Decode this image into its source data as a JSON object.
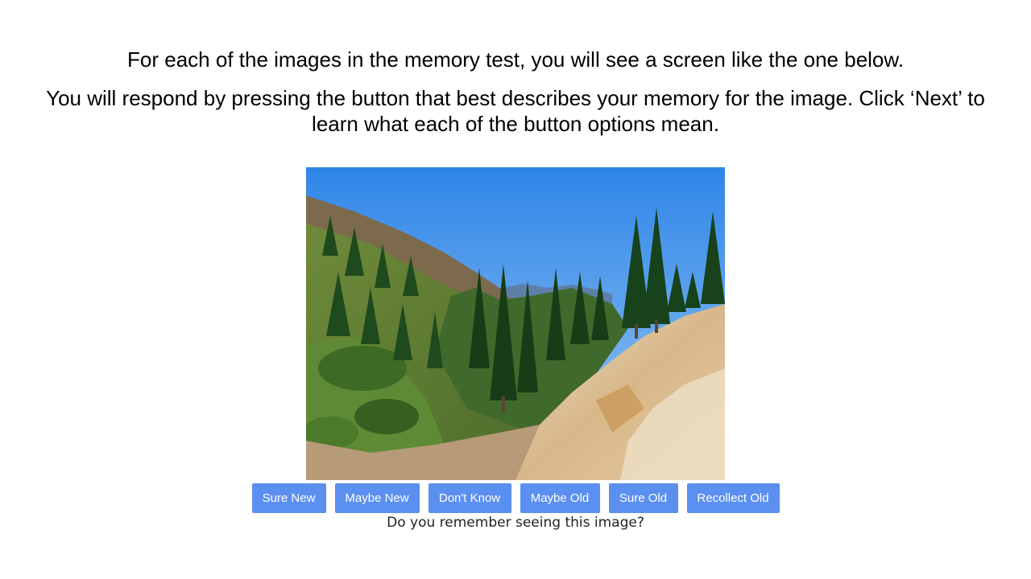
{
  "instructions": {
    "line1": "For each of the images in the memory test, you will see a screen like the one below.",
    "line2": "You will respond by pressing the button that best describes your memory for the image. Click ‘Next’ to learn what each of the button options mean."
  },
  "image": {
    "subject": "mountain-valley-photo"
  },
  "response_buttons": [
    {
      "label": "Sure New"
    },
    {
      "label": "Maybe New"
    },
    {
      "label": "Don't Know"
    },
    {
      "label": "Maybe Old"
    },
    {
      "label": "Sure Old"
    },
    {
      "label": "Recollect Old"
    }
  ],
  "prompt": "Do you remember seeing this image?",
  "colors": {
    "button_bg": "#5b8ff0",
    "button_text": "#ffffff",
    "page_bg": "#ffffff"
  }
}
